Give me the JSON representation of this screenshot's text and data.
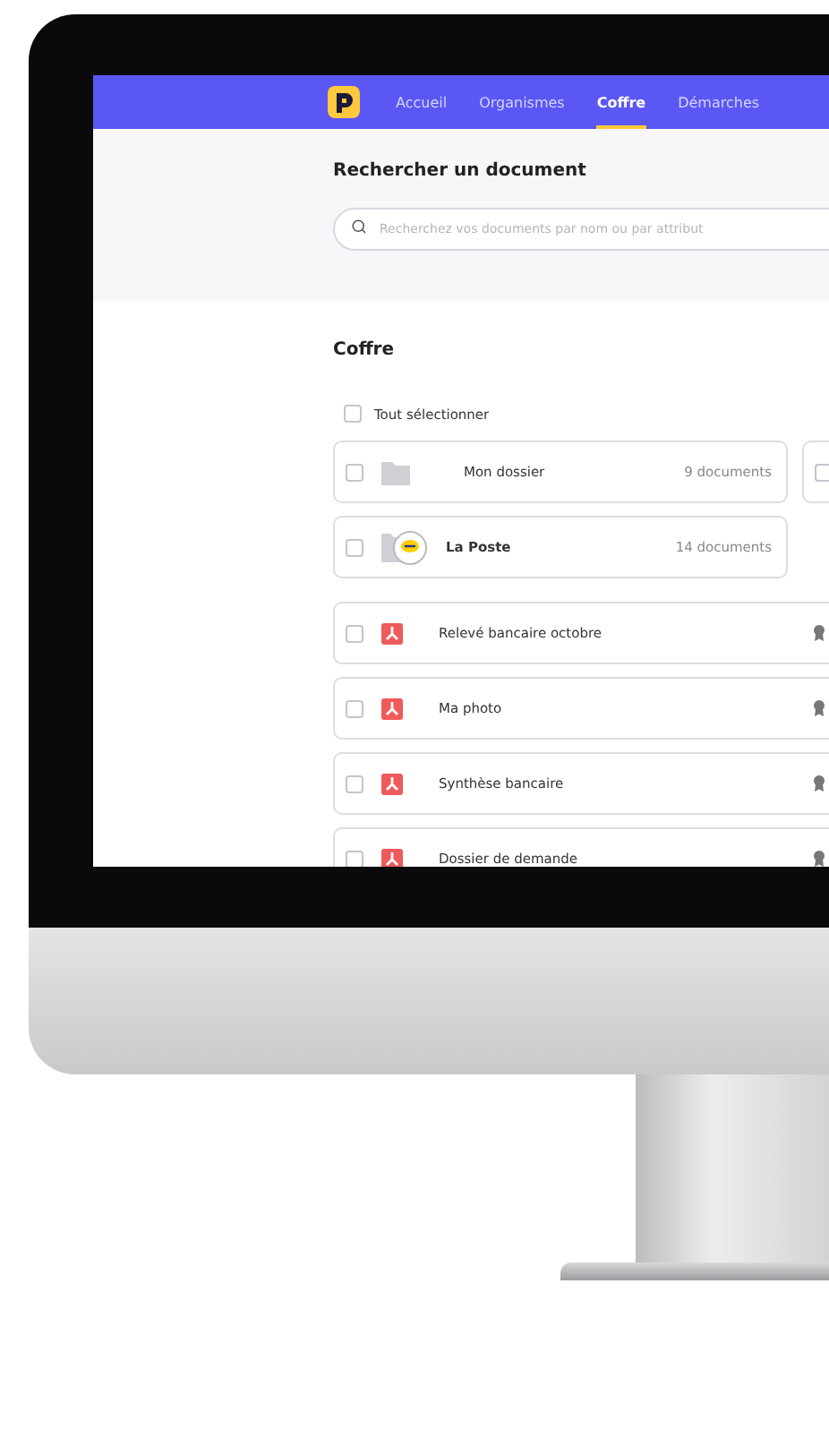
{
  "nav": {
    "items": [
      {
        "label": "Accueil",
        "selected": false
      },
      {
        "label": "Organismes",
        "selected": false
      },
      {
        "label": "Coffre",
        "selected": true
      },
      {
        "label": "Démarches",
        "selected": false
      }
    ]
  },
  "search": {
    "title": "Rechercher un document",
    "placeholder": "Recherchez vos documents par nom ou par attribut"
  },
  "vault": {
    "title": "Coffre",
    "select_all": {
      "label": "Tout sélectionner",
      "checked": false
    },
    "folders": [
      {
        "kind": "folder",
        "name": "Mon dossier",
        "count": "9 documents",
        "checked": false
      },
      {
        "kind": "folder",
        "checked": false
      },
      {
        "kind": "organisation",
        "name": "La Poste",
        "count": "14 documents",
        "checked": false
      }
    ],
    "documents": [
      {
        "kind": "pdf",
        "name": "Relevé bancaire octobre",
        "checked": false
      },
      {
        "kind": "pdf",
        "name": "Ma photo",
        "checked": false
      },
      {
        "kind": "pdf",
        "name": "Synthèse bancaire",
        "checked": false
      },
      {
        "kind": "pdf",
        "name": "Dossier de demande",
        "checked": false
      }
    ]
  }
}
